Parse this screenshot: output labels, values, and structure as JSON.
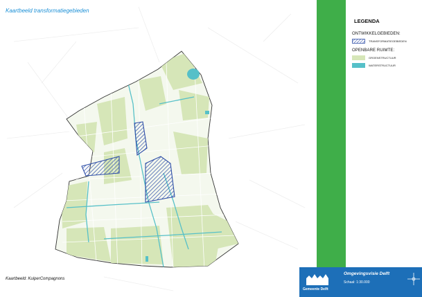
{
  "map_title": "Kaartbeeld transformatiegebieden",
  "credit": "Kaartbeeld: KuiperCompagnons",
  "legend": {
    "title": "LEGENDA",
    "sections": [
      {
        "heading": "ONTWIKKELGEBIEDEN:",
        "items": [
          {
            "label": "TRANSFORMATIEGEBIEDEN",
            "style": "hatch",
            "color": "#2f4fa8"
          }
        ]
      },
      {
        "heading": "OPENBARE RUIMTE:",
        "items": [
          {
            "label": "GROENSTRUCTUUR",
            "style": "fill",
            "color": "#d6e6b8"
          },
          {
            "label": "WATERSTRUCTUUR",
            "style": "fill",
            "color": "#56c0c8"
          }
        ]
      }
    ]
  },
  "title_block": {
    "organisation": "Gemeente Delft",
    "document": "Omgevingsvisie Delft",
    "scale": "Schaal: 1:30.000"
  },
  "colors": {
    "accent_green": "#3fae49",
    "title_blue": "#1d6fb8",
    "title_color": "#1a8fd6",
    "green_structure": "#d6e6b8",
    "water_structure": "#56c0c8",
    "hatch": "#2f4fa8"
  },
  "icons": {
    "logo": "delft-logo-icon",
    "compass": "north-arrow-icon"
  }
}
